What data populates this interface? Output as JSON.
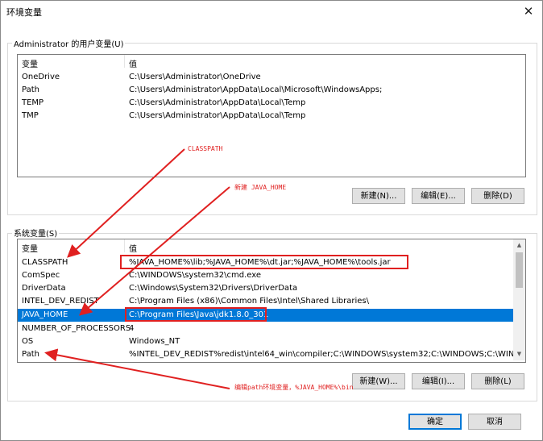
{
  "window": {
    "title": "环境变量",
    "close_symbol": "✕"
  },
  "user_vars": {
    "group_label": "Administrator 的用户变量(U)",
    "col_variable": "变量",
    "col_value": "值",
    "rows": [
      {
        "name": "OneDrive",
        "value": "C:\\Users\\Administrator\\OneDrive"
      },
      {
        "name": "Path",
        "value": "C:\\Users\\Administrator\\AppData\\Local\\Microsoft\\WindowsApps;"
      },
      {
        "name": "TEMP",
        "value": "C:\\Users\\Administrator\\AppData\\Local\\Temp"
      },
      {
        "name": "TMP",
        "value": "C:\\Users\\Administrator\\AppData\\Local\\Temp"
      }
    ],
    "buttons": {
      "new": "新建(N)...",
      "edit": "编辑(E)...",
      "delete": "删除(D)"
    }
  },
  "system_vars": {
    "group_label": "系统变量(S)",
    "col_variable": "变量",
    "col_value": "值",
    "rows": [
      {
        "name": "CLASSPATH",
        "value": "%JAVA_HOME%\\lib;%JAVA_HOME%\\dt.jar;%JAVA_HOME%\\tools.jar"
      },
      {
        "name": "ComSpec",
        "value": "C:\\WINDOWS\\system32\\cmd.exe"
      },
      {
        "name": "DriverData",
        "value": "C:\\Windows\\System32\\Drivers\\DriverData"
      },
      {
        "name": "INTEL_DEV_REDIST",
        "value": "C:\\Program Files (x86)\\Common Files\\Intel\\Shared Libraries\\"
      },
      {
        "name": "JAVA_HOME",
        "value": "C:\\Program Files\\Java\\jdk1.8.0_301"
      },
      {
        "name": "NUMBER_OF_PROCESSORS",
        "value": "4"
      },
      {
        "name": "OS",
        "value": "Windows_NT"
      },
      {
        "name": "Path",
        "value": "%INTEL_DEV_REDIST%redist\\intel64_win\\compiler;C:\\WINDOWS\\system32;C:\\WINDOWS;C:\\WINDOW..."
      }
    ],
    "selected_row": "JAVA_HOME",
    "buttons": {
      "new": "新建(W)...",
      "edit": "编辑(I)...",
      "delete": "删除(L)"
    }
  },
  "annotations": {
    "classpath": "CLASSPATH",
    "new_java_home": "新建 JAVA_HOME",
    "edit_path": "编辑path环境变量，%JAVA_HOME%\\bin"
  },
  "footer": {
    "ok": "确定",
    "cancel": "取消"
  },
  "colors": {
    "selection": "#0078d7",
    "annotation": "#e02020"
  }
}
